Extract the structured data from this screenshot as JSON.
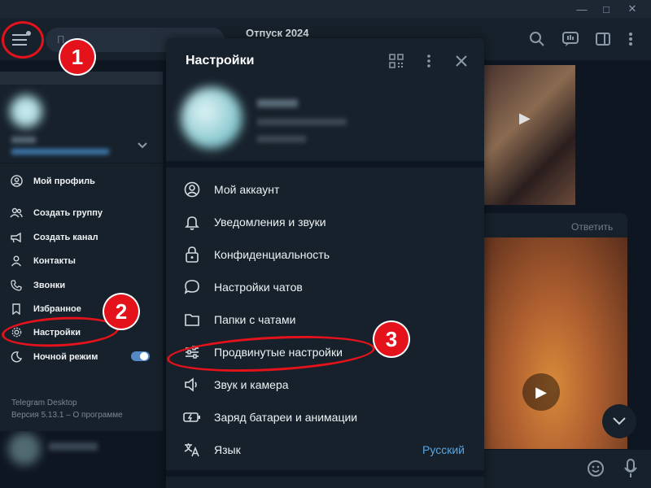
{
  "chat": {
    "title": "Отпуск 2024",
    "search_placeholder": "П",
    "reply_label": "Ответить"
  },
  "sidebar": {
    "items": [
      {
        "label": "Мой профиль",
        "icon": "profile-icon"
      },
      {
        "label": "Создать группу",
        "icon": "group-icon"
      },
      {
        "label": "Создать канал",
        "icon": "channel-icon"
      },
      {
        "label": "Контакты",
        "icon": "contacts-icon"
      },
      {
        "label": "Звонки",
        "icon": "phone-icon"
      },
      {
        "label": "Избранное",
        "icon": "bookmark-icon"
      },
      {
        "label": "Настройки",
        "icon": "gear-icon"
      },
      {
        "label": "Ночной режим",
        "icon": "moon-icon"
      }
    ],
    "night_mode_on": true,
    "app_name": "Telegram Desktop",
    "app_version": "Версия 5.13.1 – О программе"
  },
  "settings": {
    "title": "Настройки",
    "items": [
      {
        "label": "Мой аккаунт",
        "icon": "account-icon"
      },
      {
        "label": "Уведомления и звуки",
        "icon": "bell-icon"
      },
      {
        "label": "Конфиденциальность",
        "icon": "lock-icon"
      },
      {
        "label": "Настройки чатов",
        "icon": "chat-bubble-icon"
      },
      {
        "label": "Папки с чатами",
        "icon": "folder-icon"
      },
      {
        "label": "Продвинутые настройки",
        "icon": "sliders-icon"
      },
      {
        "label": "Звук и камера",
        "icon": "speaker-icon"
      },
      {
        "label": "Заряд батареи и анимации",
        "icon": "battery-icon"
      },
      {
        "label": "Язык",
        "icon": "translate-icon",
        "value": "Русский"
      }
    ]
  },
  "annotations": {
    "step1": "1",
    "step2": "2",
    "step3": "3",
    "color": "#e4121b"
  },
  "colors": {
    "accent": "#5ba4e0",
    "panel": "#17212b",
    "background": "#0e1621"
  }
}
